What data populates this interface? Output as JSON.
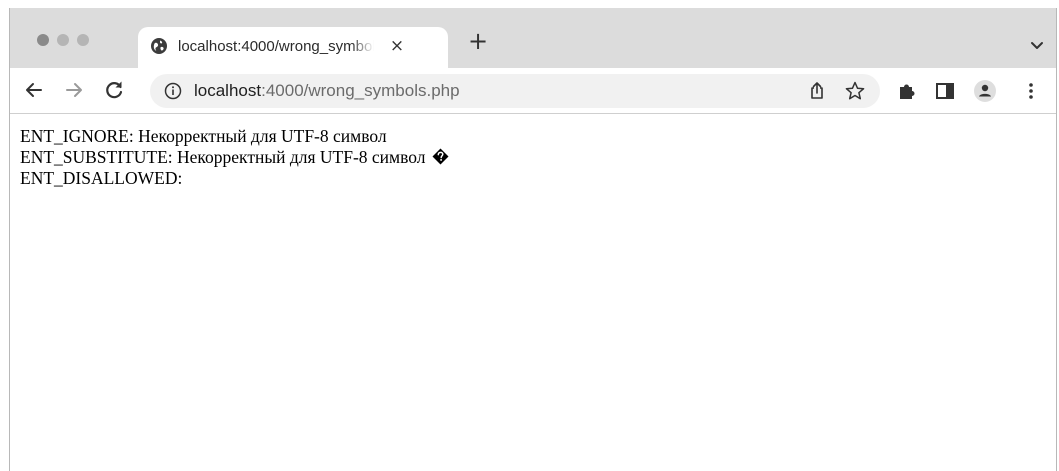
{
  "browser": {
    "tab": {
      "title": "localhost:4000/wrong_symbols.php",
      "close_glyph": "×",
      "favicon": "globe-icon"
    },
    "new_tab_glyph": "+",
    "address_bar": {
      "host": "localhost",
      "path": ":4000/wrong_symbols.php"
    },
    "toolbar_icons": [
      "back-icon",
      "forward-icon",
      "reload-icon",
      "info-icon",
      "share-icon",
      "star-icon",
      "extensions-icon",
      "side-panel-icon",
      "profile-icon",
      "menu-icon"
    ]
  },
  "page": {
    "lines": [
      {
        "label": "ENT_IGNORE:",
        "text": "Некорректный для UTF-8 символ"
      },
      {
        "label": "ENT_SUBSTITUTE:",
        "text": "Некорректный для UTF-8 символ"
      },
      {
        "label": "ENT_DISALLOWED:",
        "text": ""
      }
    ]
  }
}
